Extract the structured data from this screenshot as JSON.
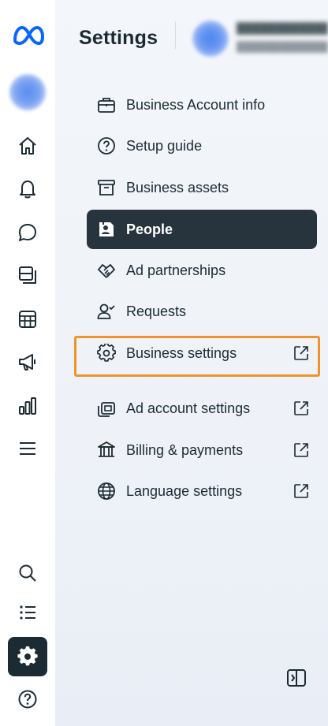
{
  "app": {
    "logo": "meta-logo",
    "accent_color": "#0866ff",
    "highlight_color": "#f0932b"
  },
  "rail": {
    "top_items": [
      {
        "icon": "home-icon",
        "name": "rail-home"
      },
      {
        "icon": "bell-icon",
        "name": "rail-notifications"
      },
      {
        "icon": "chat-icon",
        "name": "rail-messages"
      },
      {
        "icon": "pages-icon",
        "name": "rail-content"
      },
      {
        "icon": "calendar-grid-icon",
        "name": "rail-planner"
      },
      {
        "icon": "megaphone-icon",
        "name": "rail-ads"
      },
      {
        "icon": "bar-chart-icon",
        "name": "rail-insights"
      },
      {
        "icon": "menu-icon",
        "name": "rail-all-tools"
      }
    ],
    "bottom_items": [
      {
        "icon": "search-icon",
        "name": "rail-search"
      },
      {
        "icon": "list-icon",
        "name": "rail-list"
      },
      {
        "icon": "gear-icon",
        "name": "rail-settings",
        "active": true
      },
      {
        "icon": "help-icon",
        "name": "rail-help"
      }
    ]
  },
  "header": {
    "title": "Settings"
  },
  "nav": {
    "items": [
      {
        "label": "Business Account info",
        "icon": "briefcase-icon",
        "external": false
      },
      {
        "label": "Setup guide",
        "icon": "question-icon",
        "external": false
      },
      {
        "label": "Business assets",
        "icon": "archive-box-icon",
        "external": false
      },
      {
        "label": "People",
        "icon": "id-badge-icon",
        "external": false,
        "selected": true
      },
      {
        "label": "Ad partnerships",
        "icon": "handshake-icon",
        "external": false
      },
      {
        "label": "Requests",
        "icon": "person-check-icon",
        "external": false
      },
      {
        "label": "Business settings",
        "icon": "gear-icon",
        "external": true,
        "highlighted": true
      },
      {
        "label": "Ad account settings",
        "icon": "ad-account-icon",
        "external": true
      },
      {
        "label": "Billing & payments",
        "icon": "bank-icon",
        "external": true
      },
      {
        "label": "Language settings",
        "icon": "globe-icon",
        "external": true
      }
    ]
  }
}
